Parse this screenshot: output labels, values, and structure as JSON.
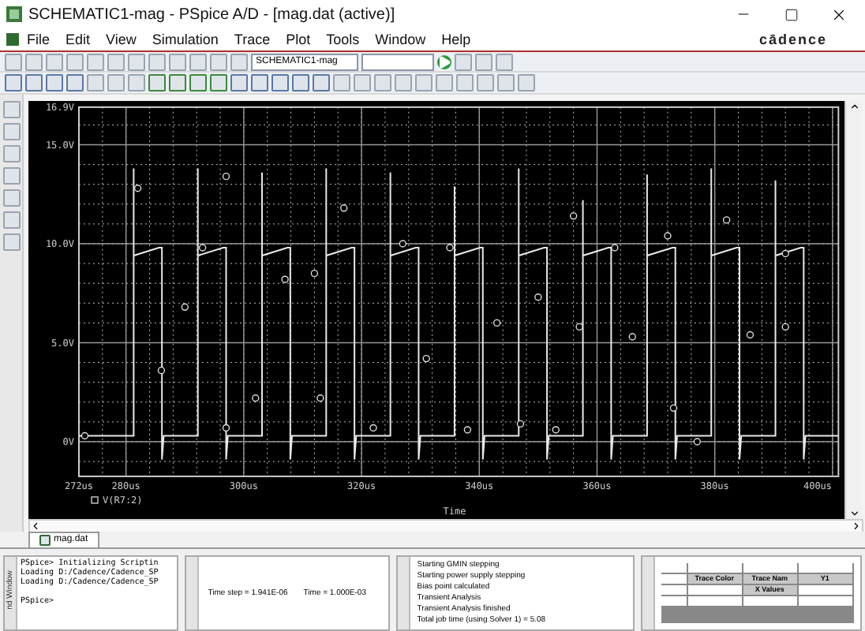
{
  "window": {
    "title": "SCHEMATIC1-mag - PSpice A/D  - [mag.dat (active)]"
  },
  "menu": {
    "items": [
      "File",
      "Edit",
      "View",
      "Simulation",
      "Trace",
      "Plot",
      "Tools",
      "Window",
      "Help"
    ],
    "logo": "cādence"
  },
  "toolbar": {
    "profile": "SCHEMATIC1-mag"
  },
  "plot": {
    "y_ticks": [
      "16.9V",
      "15.0V",
      "10.0V",
      "5.0V",
      "0V"
    ],
    "x_ticks": [
      "272us",
      "280us",
      "300us",
      "320us",
      "340us",
      "360us",
      "380us",
      "400us"
    ],
    "legend": "V(R7:2)",
    "x_label": "Time"
  },
  "file_tab": "mag.dat",
  "command_window": {
    "label": "nd Window",
    "lines": [
      "PSpice> Initializing Scriptin",
      "Loading D:/Cadence/Cadence_SP",
      "Loading D:/Cadence/Cadence_SP",
      "PSpice>"
    ]
  },
  "progress": {
    "time_step": "Time step = 1.941E-06",
    "time": "Time = 1.000E-03"
  },
  "log": {
    "lines": [
      "Starting GMIN stepping",
      "Starting power supply stepping",
      "Bias point calculated",
      "Transient Analysis",
      "Transient Analysis finished",
      "Total job time (using Solver 1)  =     5.08"
    ]
  },
  "probe_table": {
    "columns": [
      "Trace Color",
      "Trace Nam",
      "Y1"
    ],
    "x_values": "X Values"
  }
}
